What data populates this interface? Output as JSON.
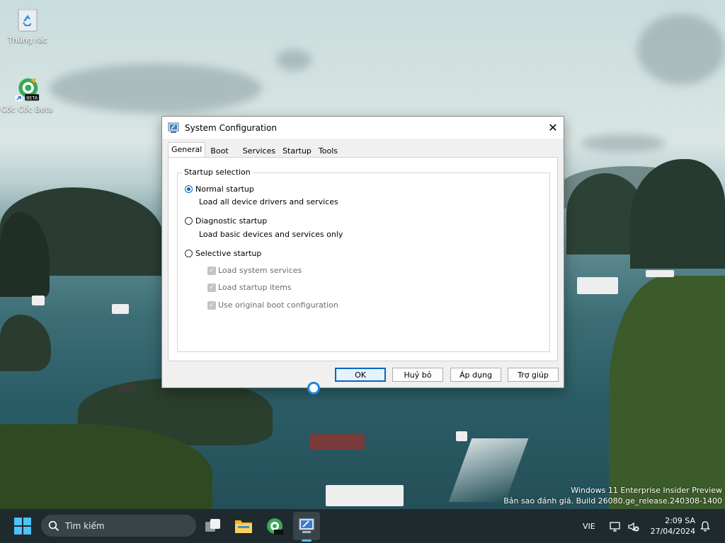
{
  "desktop": {
    "icons": [
      {
        "label": "Thùng rác"
      },
      {
        "label": "Cốc Cốc Beta",
        "badge": "BETA"
      }
    ],
    "watermark": {
      "line1": "Windows 11 Enterprise Insider Preview",
      "line2": "Bản sao đánh giá. Build 26080.ge_release.240308-1400"
    }
  },
  "dialog": {
    "title": "System Configuration",
    "close_glyph": "✕",
    "tabs": [
      {
        "label": "General",
        "active": true
      },
      {
        "label": "Boot"
      },
      {
        "label": "Services"
      },
      {
        "label": "Startup"
      },
      {
        "label": "Tools"
      }
    ],
    "group_title": "Startup selection",
    "options": [
      {
        "label": "Normal startup",
        "description": "Load all device drivers and services",
        "selected": true
      },
      {
        "label": "Diagnostic startup",
        "description": "Load basic devices and services only",
        "selected": false
      },
      {
        "label": "Selective startup",
        "selected": false
      }
    ],
    "selective_items": [
      {
        "label": "Load system services",
        "checked": true,
        "enabled": false
      },
      {
        "label": "Load startup items",
        "checked": true,
        "enabled": false
      },
      {
        "label": "Use original boot configuration",
        "checked": true,
        "enabled": false
      }
    ],
    "buttons": {
      "ok": "OK",
      "cancel": "Huỷ bỏ",
      "apply": "Áp dụng",
      "help": "Trợ giúp"
    }
  },
  "taskbar": {
    "search_placeholder": "Tìm kiếm",
    "language": "VIE",
    "time": "2:09 SA",
    "date": "27/04/2024"
  },
  "colors": {
    "accent": "#0067c0",
    "taskbar": "#1f2a2f",
    "start_blue": "#4cc2ff"
  }
}
